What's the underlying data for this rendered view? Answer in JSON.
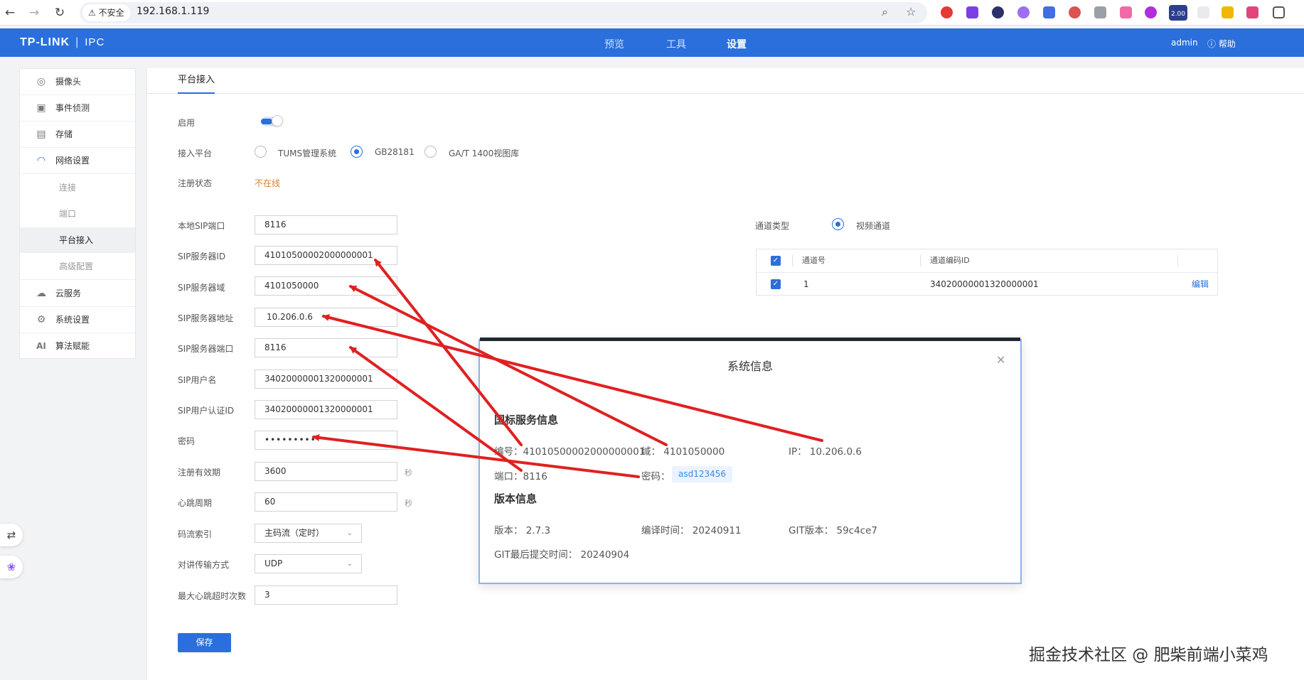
{
  "browser": {
    "security_label": "不安全",
    "url": "192.168.1.119",
    "extension_badge": "2.00"
  },
  "header": {
    "brand": "TP-LINK",
    "product": "IPC",
    "tabs": [
      "预览",
      "工具",
      "设置"
    ],
    "active_tab": "设置",
    "user": "admin",
    "help": "帮助"
  },
  "sidebar": {
    "items": [
      {
        "label": "摄像头",
        "icon": "camera-icon"
      },
      {
        "label": "事件侦测",
        "icon": "event-icon"
      },
      {
        "label": "存储",
        "icon": "storage-icon"
      },
      {
        "label": "网络设置",
        "icon": "wifi-icon"
      },
      {
        "label": "云服务",
        "icon": "cloud-icon"
      },
      {
        "label": "系统设置",
        "icon": "gear-icon"
      },
      {
        "label": "算法赋能",
        "icon": "ai-icon"
      }
    ],
    "network_sub": [
      "连接",
      "端口",
      "平台接入",
      "高级配置"
    ],
    "active_sub": "平台接入"
  },
  "main": {
    "tab": "平台接入",
    "enable_label": "启用",
    "enabled": true,
    "platform_label": "接入平台",
    "platform_options": [
      "TUMS管理系统",
      "GB28181",
      "GA/T 1400视图库"
    ],
    "platform_selected": "GB28181",
    "status_label": "注册状态",
    "status_value": "不在线",
    "fields": {
      "local_sip_port": {
        "label": "本地SIP端口",
        "value": "8116"
      },
      "sip_server_id": {
        "label": "SIP服务器ID",
        "value": "41010500002000000001"
      },
      "sip_server_domain": {
        "label": "SIP服务器域",
        "value": "4101050000"
      },
      "sip_server_addr": {
        "label": "SIP服务器地址",
        "value": "10.206.0.6"
      },
      "sip_server_port": {
        "label": "SIP服务器端口",
        "value": "8116"
      },
      "sip_username": {
        "label": "SIP用户名",
        "value": "34020000001320000001"
      },
      "sip_auth_id": {
        "label": "SIP用户认证ID",
        "value": "34020000001320000001"
      },
      "password": {
        "label": "密码",
        "value": "•••••••••"
      },
      "reg_valid": {
        "label": "注册有效期",
        "value": "3600",
        "unit": "秒"
      },
      "heartbeat": {
        "label": "心跳周期",
        "value": "60",
        "unit": "秒"
      },
      "stream_index": {
        "label": "码流索引",
        "value": "主码流（定时）"
      },
      "talk_transport": {
        "label": "对讲传输方式",
        "value": "UDP"
      },
      "max_heartbeat_timeout": {
        "label": "最大心跳超时次数",
        "value": "3"
      }
    },
    "save_label": "保存",
    "channel_type_label": "通道类型",
    "channel_type_value": "视频通道",
    "channel_table": {
      "headers": [
        "通道号",
        "通道编码ID"
      ],
      "rows": [
        {
          "no": "1",
          "code": "34020000001320000001",
          "action": "编辑"
        }
      ]
    }
  },
  "dialog": {
    "title": "系统信息",
    "gb_section": "国标服务信息",
    "gb": {
      "id": "编号：41010500002000000001",
      "domain": "域： 4101050000",
      "ip": "IP：  10.206.0.6",
      "port": "端口：8116",
      "password_label": "密码：",
      "password_value": "asd123456"
    },
    "version_section": "版本信息",
    "version": {
      "version": "版本：  2.7.3",
      "build_time": "编译时间：  20240911",
      "git": "GIT版本：  59c4ce7",
      "git_commit_time": "GIT最后提交时间：  20240904"
    }
  },
  "colors": {
    "header_bg": "#2a6fdb",
    "accent": "#2a6fdb",
    "status_offline": "#e07b26",
    "arrow": "#e02020"
  },
  "watermark": "掘金技术社区 @ 肥柴前端小菜鸡"
}
